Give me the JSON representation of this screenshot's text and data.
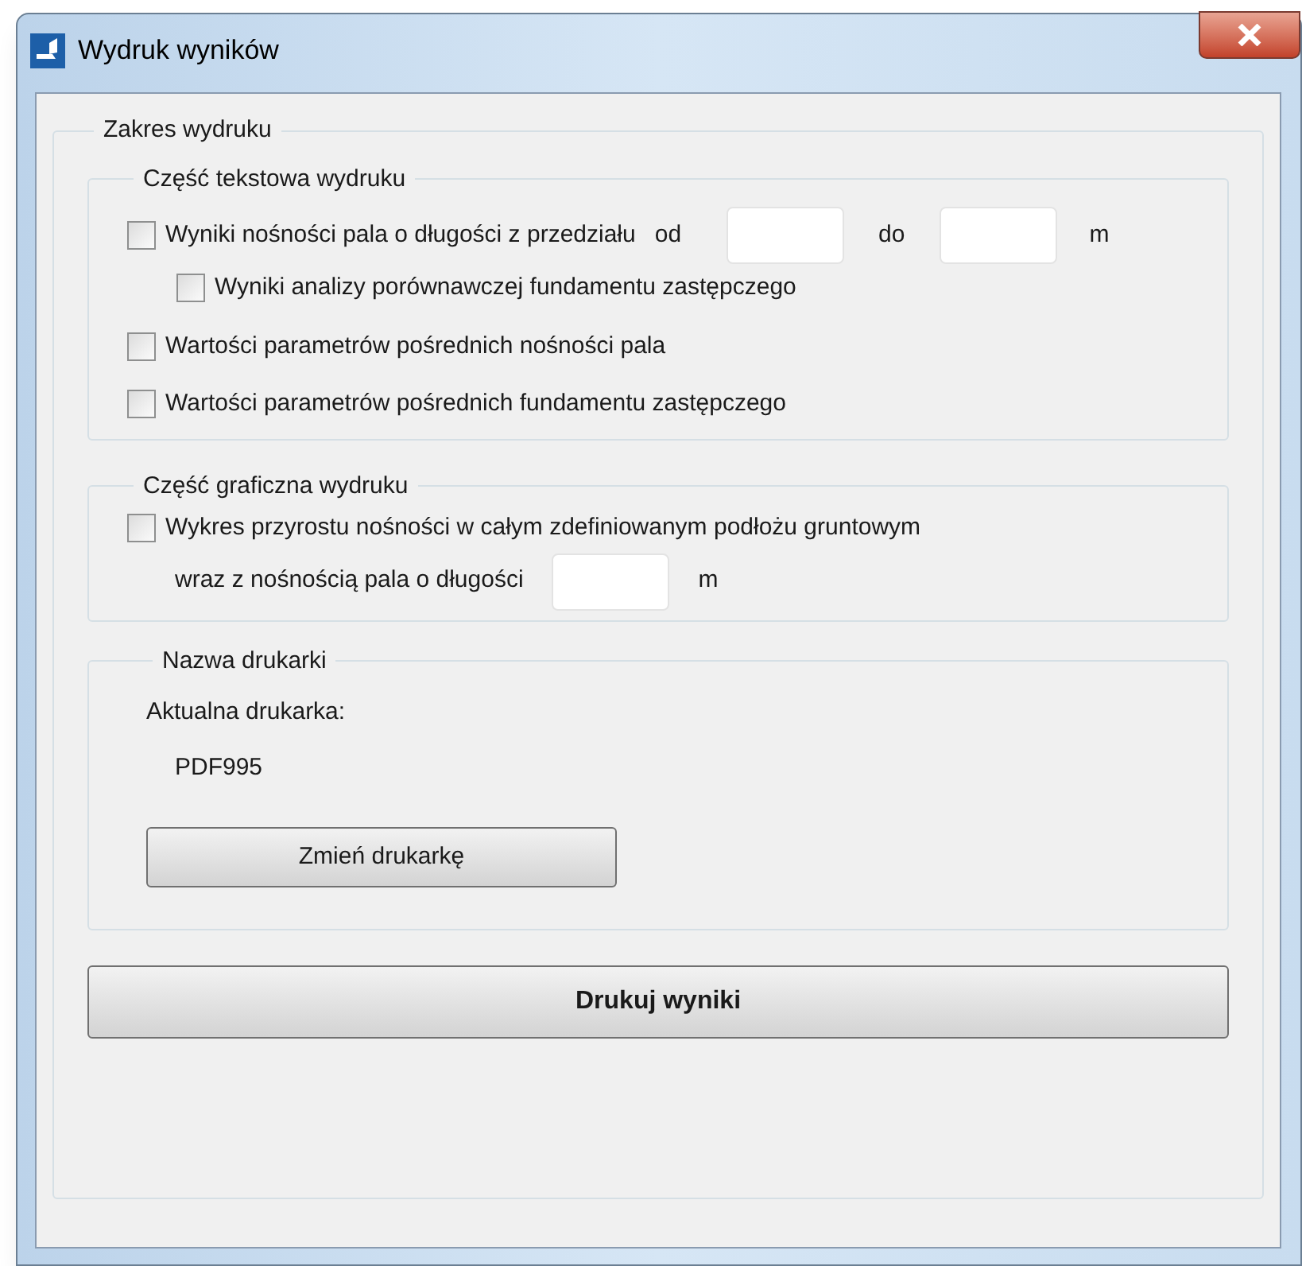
{
  "window": {
    "title": "Wydruk wyników"
  },
  "range_group": {
    "title": "Zakres wydruku"
  },
  "text_part": {
    "title": "Część tekstowa wydruku",
    "items": [
      {
        "kind": "range",
        "label": "Wyniki nośności pala o długości z przedziału",
        "checked": false,
        "from_label": "od",
        "to_label": "do",
        "unit": "m"
      },
      {
        "kind": "nested",
        "label": "Wyniki analizy porównawczej fundamentu zastępczego",
        "checked": false
      },
      {
        "kind": "plain",
        "label": "Wartości parametrów pośrednich nośności pala",
        "checked": false
      },
      {
        "kind": "plain",
        "label": "Wartości parametrów pośrednich fundamentu zastępczego",
        "checked": false
      }
    ]
  },
  "graphic_part": {
    "title": "Część graficzna wydruku",
    "label": "Wykres przyrostu nośności w całym zdefiniowanym podłożu gruntowym",
    "checked": false,
    "length_label": "wraz z nośnością pala o długości",
    "unit": "m"
  },
  "printer": {
    "title": "Nazwa drukarki",
    "current_label": "Aktualna drukarka:",
    "name": "PDF995",
    "change_button": "Zmień drukarkę"
  },
  "print_button": "Drukuj wyniki"
}
